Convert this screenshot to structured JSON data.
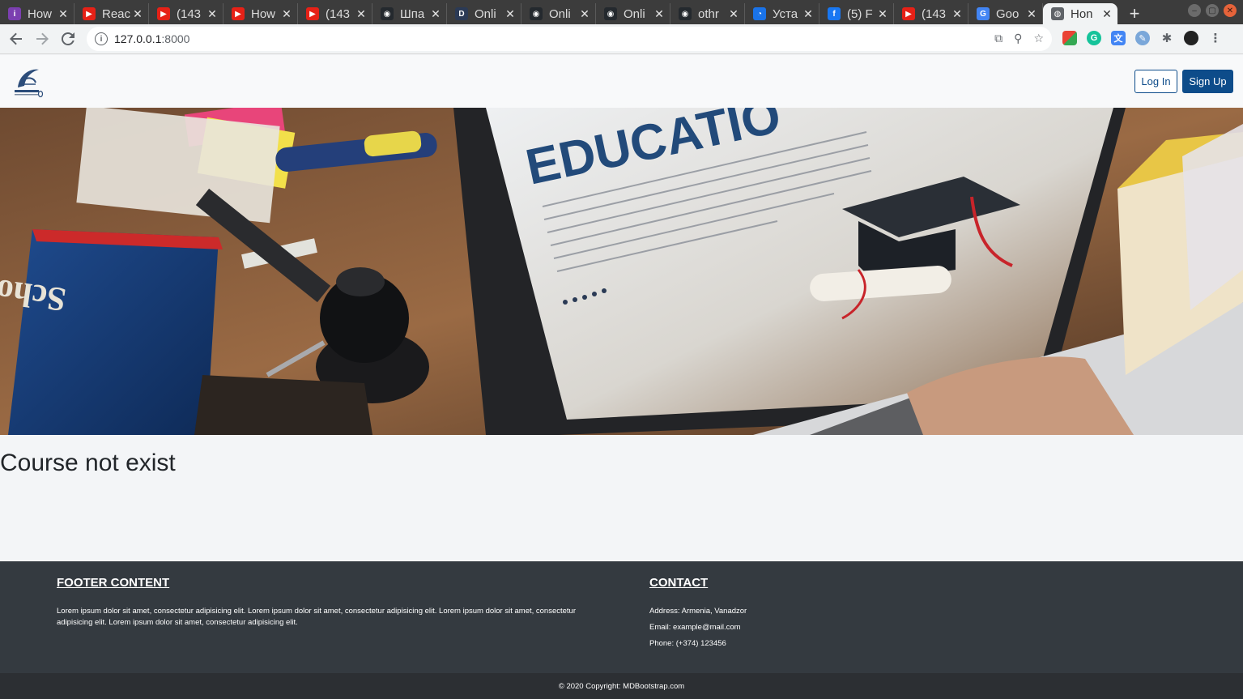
{
  "browser": {
    "tabs": [
      {
        "title": "How",
        "icon_color": "#7b3fb0",
        "icon_char": "i",
        "icon": "quora-icon"
      },
      {
        "title": "Reac",
        "icon_color": "#e62117",
        "icon_char": "▶",
        "icon": "youtube-icon"
      },
      {
        "title": "(143",
        "icon_color": "#e62117",
        "icon_char": "▶",
        "icon": "youtube-icon"
      },
      {
        "title": "How",
        "icon_color": "#e62117",
        "icon_char": "▶",
        "icon": "youtube-icon"
      },
      {
        "title": "(143",
        "icon_color": "#e62117",
        "icon_char": "▶",
        "icon": "youtube-icon"
      },
      {
        "title": "Шпа",
        "icon_color": "#24292e",
        "icon_char": "◉",
        "icon": "github-icon"
      },
      {
        "title": "Onli",
        "icon_color": "#2b3a55",
        "icon_char": "D",
        "icon": "d-icon"
      },
      {
        "title": "Onli",
        "icon_color": "#24292e",
        "icon_char": "◉",
        "icon": "github-icon"
      },
      {
        "title": "Onli",
        "icon_color": "#24292e",
        "icon_char": "◉",
        "icon": "github-icon"
      },
      {
        "title": "othr",
        "icon_color": "#24292e",
        "icon_char": "◉",
        "icon": "github-icon"
      },
      {
        "title": "Уста",
        "icon_color": "#1a73e8",
        "icon_char": "◔",
        "icon": "spinner-icon"
      },
      {
        "title": "(5) F",
        "icon_color": "#1877f2",
        "icon_char": "f",
        "icon": "facebook-icon"
      },
      {
        "title": "(143",
        "icon_color": "#e62117",
        "icon_char": "▶",
        "icon": "youtube-icon"
      },
      {
        "title": "Goo",
        "icon_color": "#4285f4",
        "icon_char": "G",
        "icon": "google-translate-icon"
      },
      {
        "title": "Hon",
        "icon_color": "#5f6368",
        "icon_char": "◍",
        "icon": "globe-icon",
        "active": true
      }
    ],
    "url": "127.0.0.1",
    "url_port": ":8000"
  },
  "site": {
    "login_label": "Log In",
    "signup_label": "Sign Up",
    "hero": {
      "screen_heading": "EDUCATIO",
      "book_title": "School Dictionary"
    }
  },
  "main": {
    "title": "Course not exist"
  },
  "footer": {
    "col1_heading": "FOOTER CONTENT",
    "col1_text": "Lorem ipsum dolor sit amet, consectetur adipisicing elit. Lorem ipsum dolor sit amet, consectetur adipisicing elit. Lorem ipsum dolor sit amet, consectetur adipisicing elit. Lorem ipsum dolor sit amet, consectetur adipisicing elit.",
    "col2_heading": "CONTACT",
    "address": "Address: Armenia, Vanadzor",
    "email": "Email: example@mail.com",
    "phone": "Phone: (+374) 123456",
    "copyright": "© 2020 Copyright: MDBootstrap.com"
  }
}
